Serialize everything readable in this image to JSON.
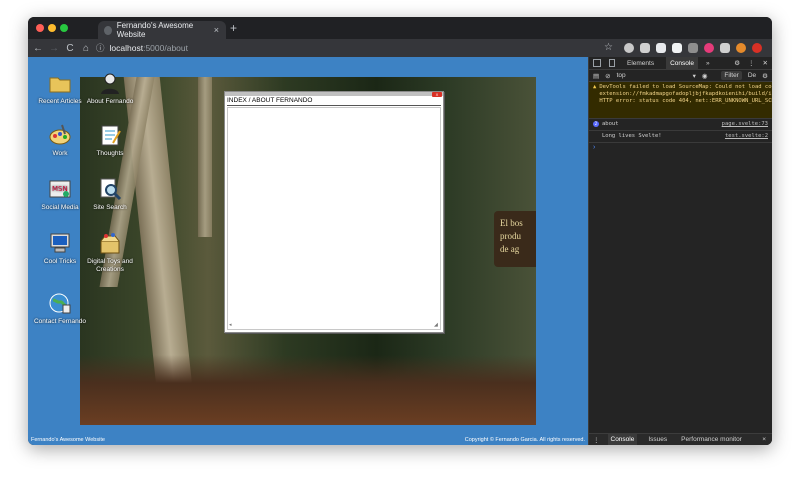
{
  "browser": {
    "tab_title": "Fernando's Awesome Website",
    "tab_close": "×",
    "new_tab": "+",
    "url_host": "localhost",
    "url_path": ":5000/about",
    "nav": {
      "back": "←",
      "forward": "→",
      "reload": "C",
      "home": "⌂",
      "info": "ⓘ",
      "star": "☆"
    }
  },
  "desktop": {
    "icons": [
      {
        "label": "Recent Articles",
        "icon": "folder-icon"
      },
      {
        "label": "About Fernando",
        "icon": "person-icon"
      },
      {
        "label": "Work",
        "icon": "paint-icon"
      },
      {
        "label": "Thoughts",
        "icon": "notepad-icon"
      },
      {
        "label": "Social Media",
        "icon": "msn-icon"
      },
      {
        "label": "Site Search",
        "icon": "search-icon"
      },
      {
        "label": "Cool Tricks",
        "icon": "computer-icon"
      },
      {
        "label": "Digital Toys and Creations",
        "icon": "box-icon"
      },
      {
        "label": "Contact Fernando",
        "icon": "globe-icon"
      }
    ],
    "sign_text": [
      "El bos",
      "produ",
      "de ag"
    ],
    "dialog": {
      "title": "INDEX / ABOUT FERNANDO",
      "close": "X"
    },
    "status_left": "Fernando's Awesome Website",
    "status_right": "Copyright © Fernando Garcia. All rights reserved."
  },
  "devtools": {
    "tabs": [
      "Elements",
      "Console"
    ],
    "more": "»",
    "context": "top",
    "filter": "Filter",
    "levels": "De",
    "messages": [
      {
        "type": "warning",
        "text": "DevTools failed to load SourceMap: Could not load content for chrome-extension://fmkadmapgofadopljbjfkapdkoienihi/build/injectGlobalHook.js.map: HTTP error: status code 404, net::ERR_UNKNOWN_URL_SCHEME",
        "source": ""
      },
      {
        "type": "log",
        "text": "about",
        "source": "page.svelte:73",
        "count": "2"
      },
      {
        "type": "log",
        "text": "Long lives Svelte!",
        "source": "test.svelte:2"
      }
    ],
    "prompt": "›",
    "drawer_tabs": [
      "Console",
      "Issues",
      "Performance monitor"
    ],
    "drawer_close": "×"
  },
  "colors": {
    "desktop_bg": "#3d82c4",
    "devtools_bg": "#242424",
    "warning_bg": "#332b00"
  }
}
